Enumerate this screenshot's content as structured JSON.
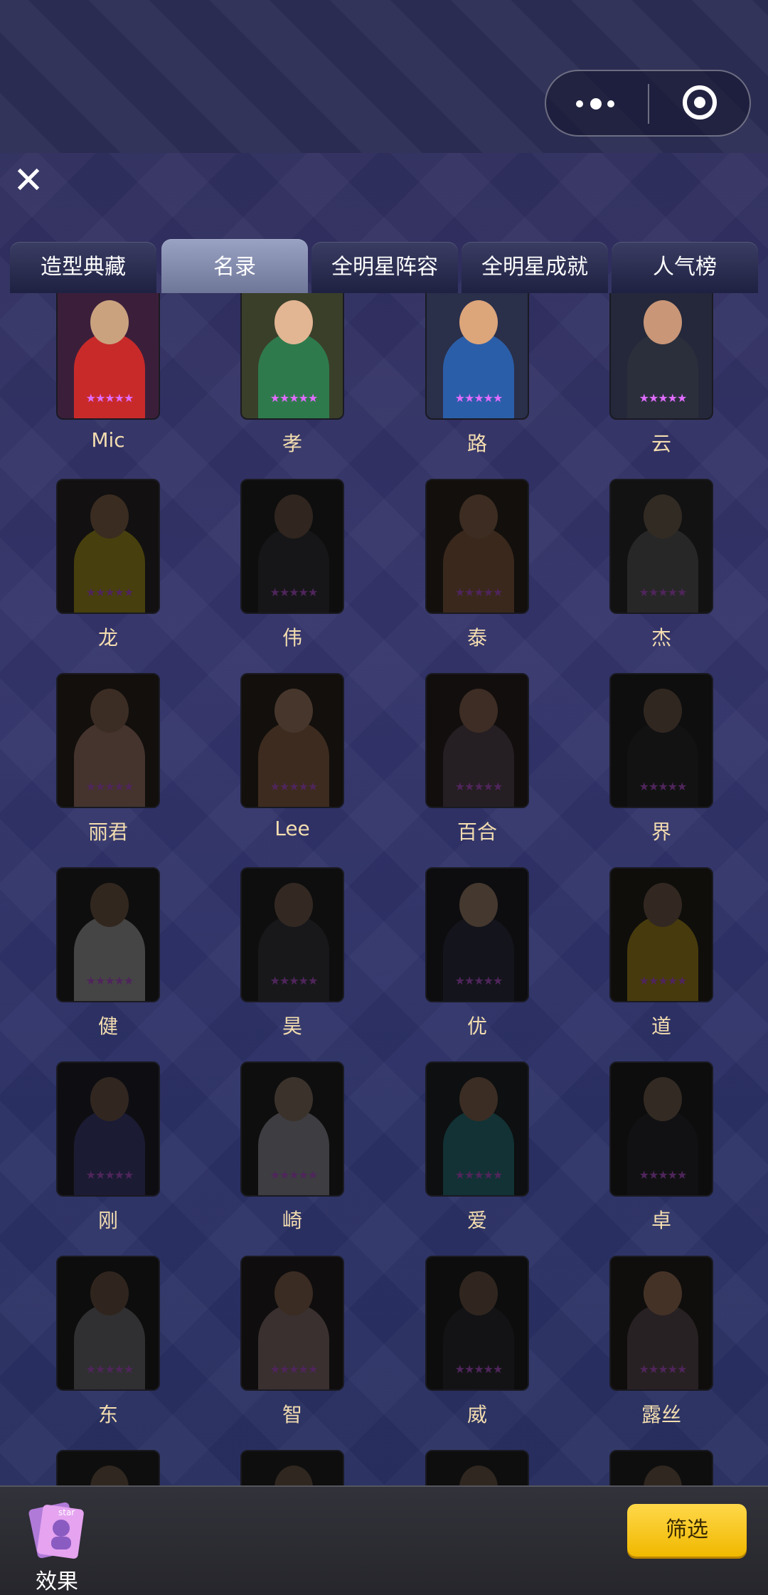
{
  "tabs": [
    {
      "label": "造型典藏",
      "active": false
    },
    {
      "label": "名录",
      "active": true
    },
    {
      "label": "全明星阵容",
      "active": false
    },
    {
      "label": "全明星成就",
      "active": false
    },
    {
      "label": "人气榜",
      "active": false
    }
  ],
  "roster": [
    {
      "name": "Mic",
      "unlocked": true
    },
    {
      "name": "孝",
      "unlocked": true
    },
    {
      "name": "路",
      "unlocked": true
    },
    {
      "name": "云",
      "unlocked": true
    },
    {
      "name": "龙",
      "unlocked": false
    },
    {
      "name": "伟",
      "unlocked": false
    },
    {
      "name": "泰",
      "unlocked": false
    },
    {
      "name": "杰",
      "unlocked": false
    },
    {
      "name": "丽君",
      "unlocked": false
    },
    {
      "name": "Lee",
      "unlocked": false
    },
    {
      "name": "百合",
      "unlocked": false
    },
    {
      "name": "界",
      "unlocked": false
    },
    {
      "name": "健",
      "unlocked": false
    },
    {
      "name": "昊",
      "unlocked": false
    },
    {
      "name": "优",
      "unlocked": false
    },
    {
      "name": "道",
      "unlocked": false
    },
    {
      "name": "刚",
      "unlocked": false
    },
    {
      "name": "崎",
      "unlocked": false
    },
    {
      "name": "爱",
      "unlocked": false
    },
    {
      "name": "卓",
      "unlocked": false
    },
    {
      "name": "东",
      "unlocked": false
    },
    {
      "name": "智",
      "unlocked": false
    },
    {
      "name": "威",
      "unlocked": false
    },
    {
      "name": "露丝",
      "unlocked": false
    },
    {
      "name": "",
      "unlocked": false
    },
    {
      "name": "",
      "unlocked": false
    },
    {
      "name": "",
      "unlocked": false
    },
    {
      "name": "",
      "unlocked": false
    }
  ],
  "star_rating": 5,
  "star_glyph": "★",
  "colors": {
    "star_lit": "#e06cff",
    "star_dim": "#7a3a8c",
    "name_text": "#f3ddb0",
    "filter_button": "#ffcf1f"
  },
  "portrait_palette": [
    {
      "bg": "#3b1f3a",
      "fig": "#c82a2a",
      "head": "#caa27e"
    },
    {
      "bg": "#3a3f2a",
      "fig": "#2f7a4c",
      "head": "#e2b593"
    },
    {
      "bg": "#2a2f4a",
      "fig": "#2b5ea8",
      "head": "#dca57a"
    },
    {
      "bg": "#24283a",
      "fig": "#2b2f3c",
      "head": "#c99677"
    },
    {
      "bg": "#1c1a1a",
      "fig": "#6e6214",
      "head": "#5a4432"
    },
    {
      "bg": "#161616",
      "fig": "#222226",
      "head": "#4a3a30"
    },
    {
      "bg": "#1e1713",
      "fig": "#5a3e2c",
      "head": "#5d4433"
    },
    {
      "bg": "#1c1c1c",
      "fig": "#3c3c3c",
      "head": "#4e4238"
    },
    {
      "bg": "#1d1713",
      "fig": "#6a5048",
      "head": "#5d4638"
    },
    {
      "bg": "#1d1713",
      "fig": "#5e4230",
      "head": "#6e5444"
    },
    {
      "bg": "#1c1614",
      "fig": "#3a2f36",
      "head": "#5e4538"
    },
    {
      "bg": "#161616",
      "fig": "#1c1c1e",
      "head": "#4c3d33"
    },
    {
      "bg": "#161616",
      "fig": "#6a6a6a",
      "head": "#4e3d31"
    },
    {
      "bg": "#161616",
      "fig": "#26262a",
      "head": "#4f3f35"
    },
    {
      "bg": "#141418",
      "fig": "#1f1f2c",
      "head": "#6a5648"
    },
    {
      "bg": "#181612",
      "fig": "#6d5a14",
      "head": "#4d3e33"
    },
    {
      "bg": "#16161c",
      "fig": "#2a2a50",
      "head": "#4e3d32"
    },
    {
      "bg": "#161616",
      "fig": "#5f5f66",
      "head": "#5b4d44"
    },
    {
      "bg": "#14181a",
      "fig": "#1d4d52",
      "head": "#5b4538"
    },
    {
      "bg": "#141414",
      "fig": "#1b1b1e",
      "head": "#4f4137"
    },
    {
      "bg": "#141414",
      "fig": "#4a4a4e",
      "head": "#4a3a2f"
    },
    {
      "bg": "#181414",
      "fig": "#5a4a4a",
      "head": "#5a4336"
    },
    {
      "bg": "#141414",
      "fig": "#1e1e22",
      "head": "#4b3b30"
    },
    {
      "bg": "#181614",
      "fig": "#3e3436",
      "head": "#6a4d3d"
    }
  ],
  "bottom_bar": {
    "effect_label": "效果",
    "effect_icon_text": "star",
    "filter_label": "筛选"
  }
}
